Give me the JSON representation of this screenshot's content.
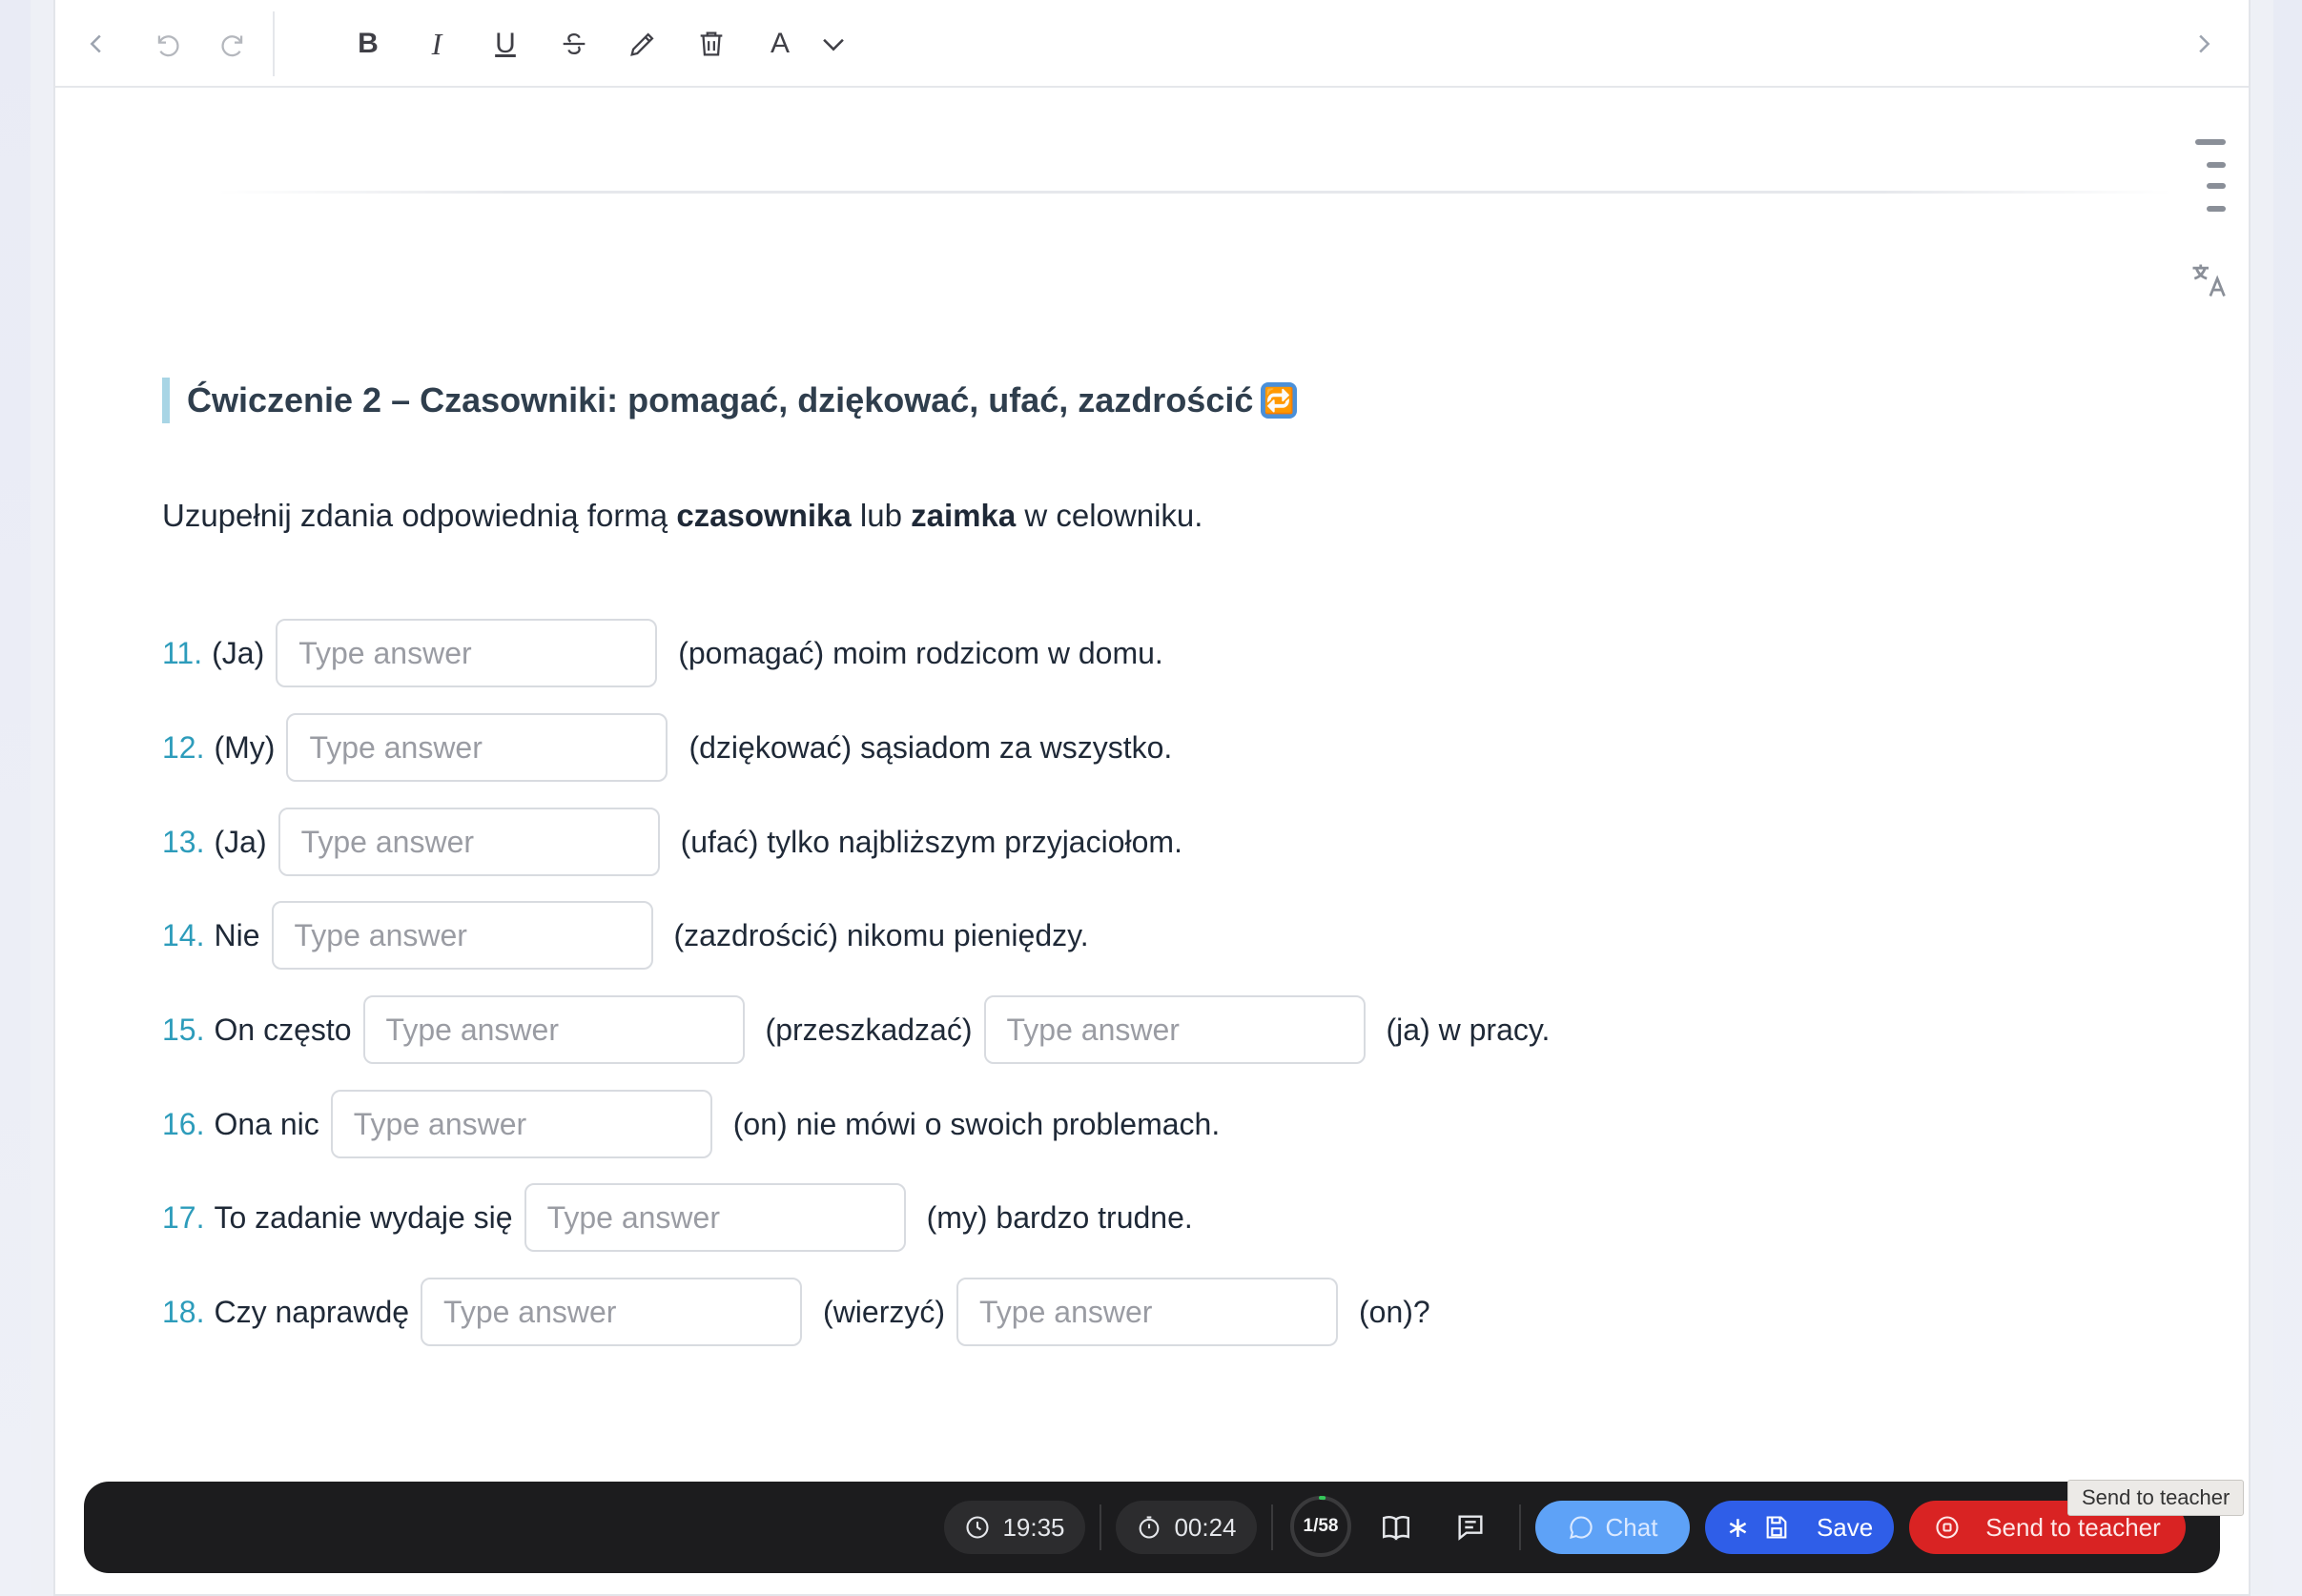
{
  "toolbar": {
    "bold": "B",
    "italic": "I",
    "underline": "U",
    "font_menu": "A"
  },
  "exercise": {
    "title": "Ćwiczenie 2 – Czasowniki: pomagać, dziękować, ufać, zazdrościć",
    "title_emoji": "🔁",
    "instruction_pre": "Uzupełnij zdania odpowiednią formą ",
    "instruction_bold1": "czasownika",
    "instruction_mid": " lub ",
    "instruction_bold2": "zaimka",
    "instruction_post": " w celowniku."
  },
  "answer_placeholder": "Type answer",
  "questions": [
    {
      "num": "11.",
      "pre": "(Ja)",
      "mid": "(pomagać) moim rodzicom w domu.",
      "post": ""
    },
    {
      "num": "12.",
      "pre": "(My)",
      "mid": "(dziękować) sąsiadom za wszystko.",
      "post": ""
    },
    {
      "num": "13.",
      "pre": "(Ja)",
      "mid": "(ufać) tylko najbliższym przyjaciołom.",
      "post": ""
    },
    {
      "num": "14.",
      "pre": "Nie",
      "mid": "(zazdrościć) nikomu pieniędzy.",
      "post": ""
    },
    {
      "num": "15.",
      "pre": "On często",
      "mid": "(przeszkadzać)",
      "post": "(ja) w pracy."
    },
    {
      "num": "16.",
      "pre": "Ona nic",
      "mid": "(on) nie mówi o swoich problemach.",
      "post": ""
    },
    {
      "num": "17.",
      "pre": "To zadanie wydaje się",
      "mid": "(my) bardzo trudne.",
      "post": ""
    },
    {
      "num": "18.",
      "pre": "Czy naprawdę",
      "mid": "(wierzyć)",
      "post": "(on)?"
    }
  ],
  "bottombar": {
    "clock_time": "19:35",
    "timer": "00:24",
    "progress_label": "1/58",
    "progress_fraction": 0.017,
    "chat_label": "Chat",
    "save_label": "Save",
    "send_label": "Send to teacher",
    "tooltip": "Send to teacher"
  },
  "colors": {
    "accent_number": "#2d9cbb",
    "chat": "#5ea2f7",
    "save": "#2f5ee8",
    "send": "#d92323",
    "bar": "#1c1c1e"
  }
}
